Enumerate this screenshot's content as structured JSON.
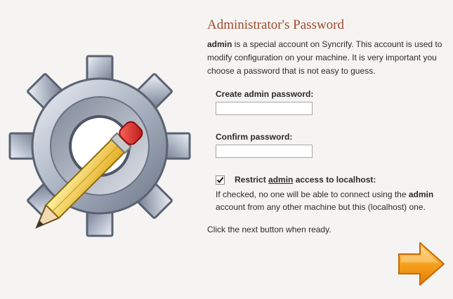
{
  "page": {
    "title": "Administrator's Password",
    "intro_bold": "admin",
    "intro_rest": " is a special account on Syncrify. This account is used to modify configuration on your machine. It is very important you choose a password that is not easy to guess."
  },
  "form": {
    "create_label": "Create admin password:",
    "create_value": "",
    "confirm_label": "Confirm password:",
    "confirm_value": "",
    "restrict": {
      "checked": true,
      "label_before": "Restrict ",
      "label_link": "admin",
      "label_after": " access to localhost:",
      "help_before": "If checked, no one will be able to connect using the ",
      "help_bold": "admin",
      "help_after": " account from any other machine but this (localhost) one."
    }
  },
  "footer": {
    "text": "Click the next button when ready."
  },
  "icons": {
    "illustration": "gear-with-pencil-icon",
    "next": "arrow-right-icon",
    "check": "check-icon"
  },
  "colors": {
    "title": "#a04a2c",
    "arrow": "#f29b1d",
    "background": "#f5f4f2"
  }
}
